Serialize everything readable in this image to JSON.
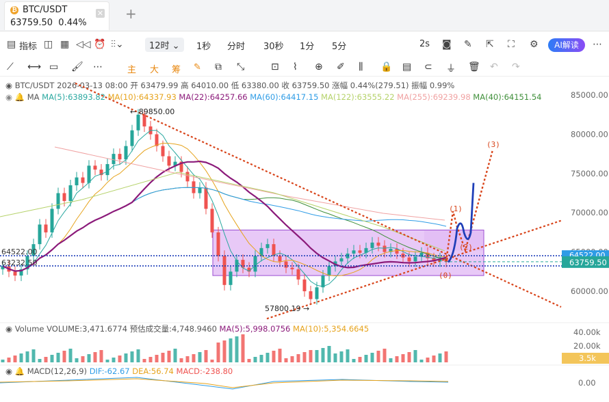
{
  "tab": {
    "pair": "BTC/USDT",
    "price": "63759.50",
    "change": "0.44%",
    "coin_icon": "bitcoin-icon"
  },
  "toolbar": {
    "indicators": "指标",
    "interval_selected": "12时",
    "intervals": [
      "1秒",
      "分时",
      "30秒",
      "1分",
      "5分"
    ],
    "refresh": "2s",
    "ai_button": "AI解读"
  },
  "draw_tools": {
    "main": "主",
    "big": "大",
    "chip": "筹"
  },
  "legend": {
    "ohlc": "BTC/USDT  2026-03-13 08:00  开 63479.99  高 64010.00  低 63380.00  收 63759.50  涨幅 0.44%(279.51)  振幅 0.99%",
    "ma_label": "MA",
    "ma": [
      {
        "text": "MA(5):63893.82",
        "color": "#2aa8a0"
      },
      {
        "text": "MA(10):64337.93",
        "color": "#e6a31c"
      },
      {
        "text": "MA(22):64257.66",
        "color": "#8b1a7a"
      },
      {
        "text": "MA(60):64417.15",
        "color": "#2e9ce6"
      },
      {
        "text": "MA(122):63555.22",
        "color": "#b5d26a"
      },
      {
        "text": "MA(255):69239.98",
        "color": "#f0a2a2"
      },
      {
        "text": "MA(40):64151.54",
        "color": "#3f8f3a"
      }
    ]
  },
  "volume_legend": {
    "label": "Volume",
    "volume": "VOLUME:3,471.6774",
    "estimate": "预估成交量:4,748.9460",
    "ma5": "MA(5):5,998.0756",
    "ma10": "MA(10):5,354.6645"
  },
  "macd_legend": {
    "label": "MACD(12,26,9)",
    "dif": "DIF:-62.67",
    "dea": "DEA:56.74",
    "macd": "MACD:-238.80"
  },
  "price_axis": [
    "85000.00",
    "80000.00",
    "75000.00",
    "70000.00",
    "65000.00",
    "60000.00"
  ],
  "volume_axis": [
    "40.00k",
    "20.00k"
  ],
  "volume_badge": "3.5k",
  "macd_axis": "0.00",
  "current_price_badge": "63759.50",
  "hidden_price_badge": "64522.00",
  "left_levels": [
    "64522.00",
    "63232.50"
  ],
  "annotations": {
    "high": "89850.00",
    "low": "57800.19",
    "wave": [
      "(0)",
      "(1)",
      "(2)",
      "(3)"
    ]
  },
  "colors": {
    "up": "#26a69a",
    "down": "#ef5350",
    "trend": "#d8441a",
    "box_fill": "#cc88ee",
    "projection": "#1f3fb8"
  },
  "chart_data": {
    "type": "candlestick",
    "ylim": [
      55000,
      87000
    ],
    "candles_close": [
      63200,
      62500,
      62000,
      62800,
      64500,
      66000,
      68500,
      67500,
      70500,
      72500,
      71500,
      73500,
      74500,
      73800,
      76000,
      75500,
      74800,
      76200,
      77500,
      76800,
      78500,
      80500,
      82500,
      81000,
      80000,
      78500,
      77200,
      76000,
      76500,
      75200,
      74000,
      72500,
      73200,
      70500,
      67500,
      64500,
      60800,
      62500,
      64000,
      63000,
      62500,
      64500,
      65500,
      66000,
      64500,
      63800,
      63000,
      62800,
      61500,
      60000,
      59000,
      60500,
      62000,
      63200,
      63800,
      64200,
      64800,
      65200,
      64900,
      65500,
      66200,
      65800,
      65000,
      65400,
      64800,
      64300,
      63800,
      64400,
      64900,
      64200,
      63800,
      64200,
      63759.5
    ],
    "box": {
      "price_top": 67800,
      "price_bottom": 62000
    },
    "resistance_line": {
      "from_price": 86500,
      "to_price": 58000
    },
    "support_line": {
      "from_price": 56500,
      "to_price": 69000
    }
  }
}
